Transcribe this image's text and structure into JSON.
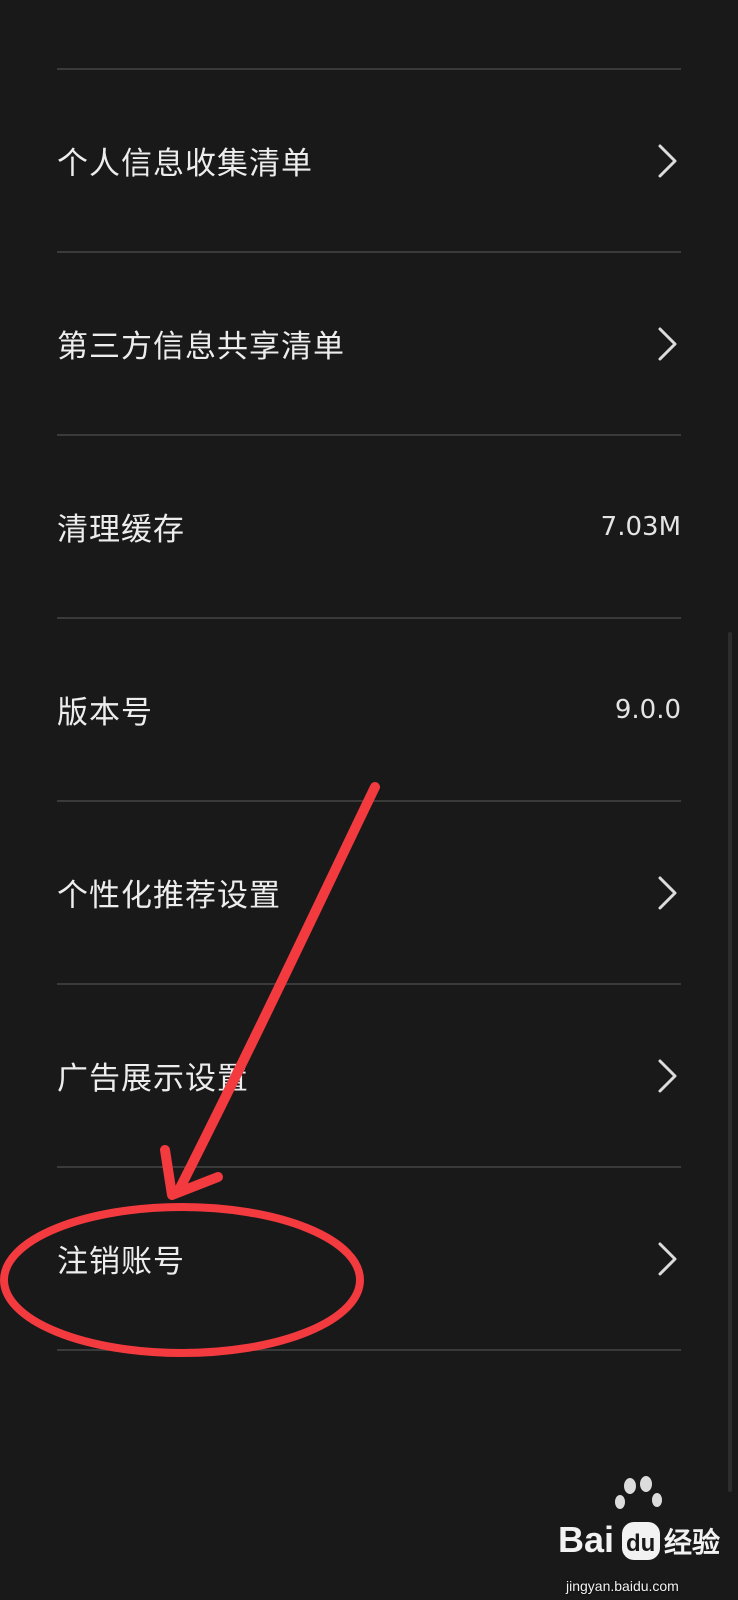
{
  "settings": {
    "items": [
      {
        "label": "个人信息收集清单",
        "value": "",
        "has_chevron": true
      },
      {
        "label": "第三方信息共享清单",
        "value": "",
        "has_chevron": true
      },
      {
        "label": "清理缓存",
        "value": "7.03M",
        "has_chevron": false
      },
      {
        "label": "版本号",
        "value": "9.0.0",
        "has_chevron": false
      },
      {
        "label": "个性化推荐设置",
        "value": "",
        "has_chevron": true
      },
      {
        "label": "广告展示设置",
        "value": "",
        "has_chevron": true
      },
      {
        "label": "注销账号",
        "value": "",
        "has_chevron": true
      }
    ]
  },
  "annotation": {
    "color": "#f23a3f",
    "shape": "arrow-and-ellipse",
    "target": "注销账号"
  },
  "watermark": {
    "brand_text": "Bai",
    "brand_du": "du",
    "brand_suffix": "经验",
    "url": "jingyan.baidu.com"
  },
  "colors": {
    "background": "#191919",
    "divider": "#3a3a3a",
    "text": "#ededed"
  },
  "icons": {
    "chevron": "chevron-right-icon"
  }
}
